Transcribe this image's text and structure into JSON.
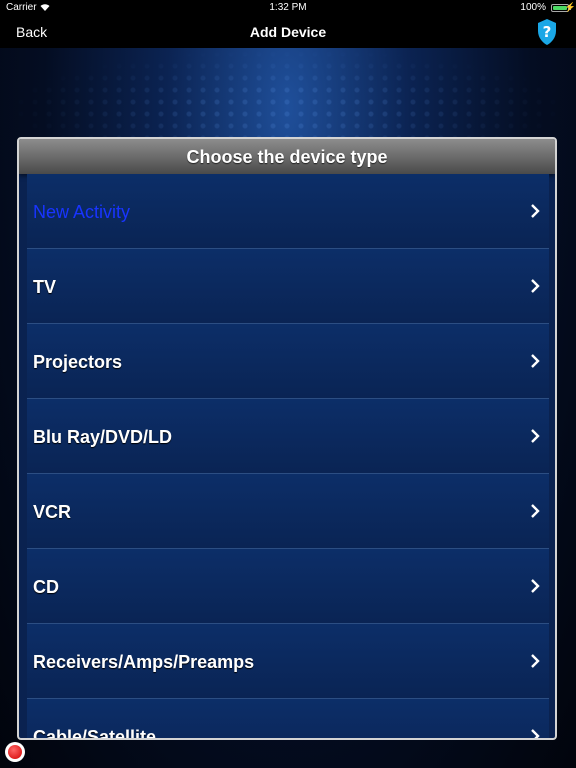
{
  "status_bar": {
    "carrier": "Carrier",
    "time": "1:32 PM",
    "battery": "100%"
  },
  "nav": {
    "back": "Back",
    "title": "Add Device",
    "help_icon": "question-shield-icon"
  },
  "panel": {
    "title": "Choose the device type",
    "items": [
      {
        "label": "New Activity"
      },
      {
        "label": "TV"
      },
      {
        "label": "Projectors"
      },
      {
        "label": "Blu Ray/DVD/LD"
      },
      {
        "label": "VCR"
      },
      {
        "label": "CD"
      },
      {
        "label": "Receivers/Amps/Preamps"
      },
      {
        "label": "Cable/Satellite"
      }
    ]
  },
  "colors": {
    "accent_item": "#1834ff",
    "help_icon": "#1aa7e6",
    "battery": "#4cd964",
    "record": "#d10000"
  }
}
